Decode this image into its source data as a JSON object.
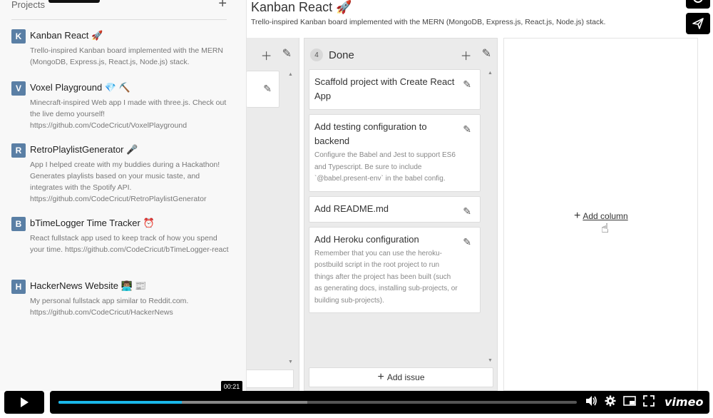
{
  "sidebar": {
    "title": "Projects",
    "add_label": "+",
    "projects": [
      {
        "avatar": "K",
        "name": "Kanban React 🚀",
        "desc": "Trello-inspired Kanban board implemented with the MERN (MongoDB, Express.js, React.js, Node.js) stack."
      },
      {
        "avatar": "V",
        "name": "Voxel Playground 💎 ⛏️",
        "desc": "Minecraft-inspired Web app I made with three.js. Check out the live demo yourself! https://github.com/CodeCricut/VoxelPlayground"
      },
      {
        "avatar": "R",
        "name": "RetroPlaylistGenerator 🎤",
        "desc": "App I helped create with my buddies during a Hackathon! Generates playlists based on your music taste, and integrates with the Spotify API. https://github.com/CodeCricut/RetroPlaylistGenerator"
      },
      {
        "avatar": "B",
        "name": "bTimeLogger Time Tracker ⏰",
        "desc": "React fullstack app used to keep track of how you spend your time. https://github.com/CodeCricut/bTimeLogger-react"
      },
      {
        "avatar": "H",
        "name": "HackerNews Website 👨🏽‍💻 📰",
        "desc": "My personal fullstack app similar to Reddit.com. https://github.com/CodeCricut/HackerNews"
      }
    ]
  },
  "main": {
    "title": "Kanban React 🚀",
    "subtitle": "Trello-inspired Kanban board implemented with the MERN (MongoDB, Express.js, React.js, Node.js) stack."
  },
  "columns": {
    "done": {
      "count": "4",
      "title": "Done",
      "cards": [
        {
          "title": "Scaffold project with Create React App",
          "body": ""
        },
        {
          "title": "Add testing configuration to backend",
          "body": "Configure the Babel and Jest to support ES6 and Typescript. Be sure to include `@babel.present-env` in the babel config."
        },
        {
          "title": "Add README.md",
          "body": ""
        },
        {
          "title": "Add Heroku configuration",
          "body": "Remember that you can use the heroku-postbuild script in the root project to run things after the project has been built (such as generating docs, installing sub-projects, or building sub-projects)."
        }
      ],
      "add_issue_label": "Add issue"
    },
    "add_column_label": "Add column"
  },
  "player": {
    "time_tooltip": "00:21",
    "progress": 0.238,
    "buffered": 0.48,
    "logo": "vimeo"
  },
  "icons": {
    "add": "plus-icon",
    "edit": "pencil-icon",
    "play": "play-icon",
    "volume": "volume-icon",
    "settings": "gear-icon",
    "pip": "picture-in-picture-icon",
    "fullscreen": "fullscreen-icon",
    "share": "paper-plane-icon"
  },
  "colors": {
    "accent": "#1ab7ea",
    "avatar": "#5a7fa5",
    "column_bg": "#ebebeb"
  }
}
